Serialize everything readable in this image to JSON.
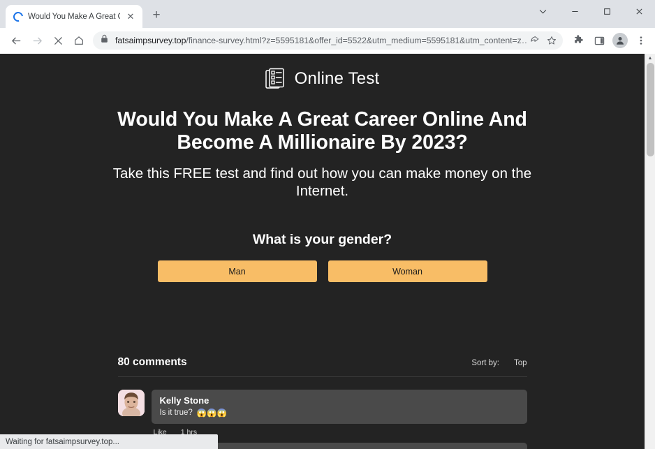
{
  "browser": {
    "tab": {
      "title": "Would You Make A Great Career",
      "spinner_icon": "loading-spinner-icon",
      "close_icon": "✕"
    },
    "new_tab_label": "+",
    "window_controls": {
      "tab_search_icon": "chevron-down-icon",
      "minimize_icon": "minimize-icon",
      "maximize_icon": "maximize-icon",
      "close_icon": "close-icon"
    },
    "nav": {
      "back_icon": "arrow-left-icon",
      "forward_icon": "arrow-right-icon",
      "stop_icon": "close-x-icon",
      "home_icon": "home-icon"
    },
    "omnibox": {
      "lock_icon": "lock-icon",
      "url_host": "fatsaimpsurvey.top",
      "url_path": "/finance-survey.html?z=5595181&offer_id=5522&utm_medium=5595181&utm_content=z…",
      "share_icon": "share-icon",
      "bookmark_icon": "star-icon"
    },
    "toolbar_icons": {
      "extensions": "puzzle-icon",
      "side_panel": "side-panel-icon",
      "profile": "profile-avatar-icon",
      "menu": "three-dot-menu-icon"
    },
    "status_text": "Waiting for fatsaimpsurvey.top...",
    "scrollbar": {
      "up_arrow": "▲"
    }
  },
  "page": {
    "logo": {
      "icon": "document-checklist-icon",
      "text": "Online Test"
    },
    "headline": "Would You Make A Great Career Online And Become A Millionaire By 2023?",
    "subhead": "Take this FREE test and find out how you can make money on the Internet.",
    "question": "What is your gender?",
    "answers": [
      {
        "label": "Man"
      },
      {
        "label": "Woman"
      }
    ],
    "comments": {
      "count_label": "80 comments",
      "sort_label": "Sort by:",
      "sort_value": "Top",
      "items": [
        {
          "author": "Kelly Stone",
          "text": "Is it true?",
          "emojis": "😱😱😱",
          "like_label": "Like",
          "time_label": "1 hrs",
          "avatar": "male-portrait-avatar"
        }
      ]
    }
  },
  "colors": {
    "page_background": "#232323",
    "accent_button": "#f8bd66",
    "comment_bubble": "#4a4a4a",
    "tab_spinner": "#1a73e8"
  }
}
